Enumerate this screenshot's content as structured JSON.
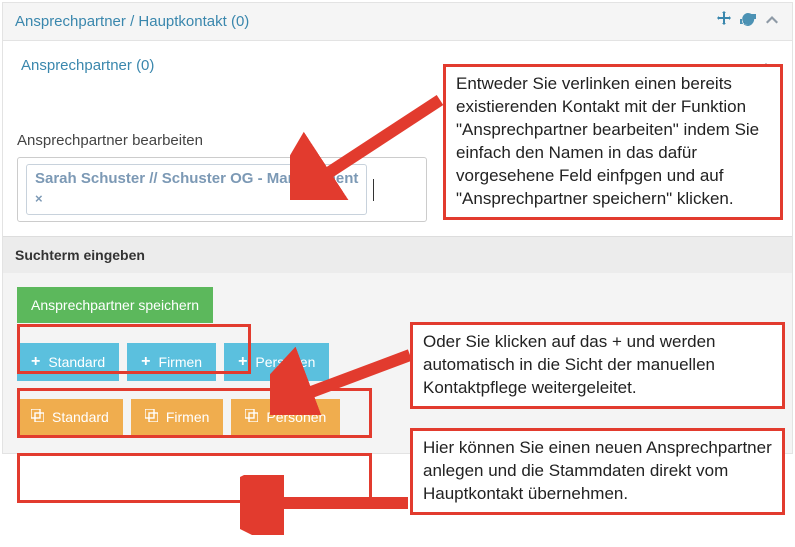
{
  "header": {
    "title": "Ansprechpartner / Hauptkontakt (0)"
  },
  "sub": {
    "title": "Ansprechpartner (0)"
  },
  "section": {
    "edit_label": "Ansprechpartner bearbeiten",
    "tag_text": "Sarah Schuster // Schuster OG - Management",
    "search_placeholder": "Suchterm eingeben"
  },
  "buttons": {
    "save": "Ansprechpartner speichern",
    "add_standard": "Standard",
    "add_firmen": "Firmen",
    "add_personen": "Personen",
    "copy_standard": "Standard",
    "copy_firmen": "Firmen",
    "copy_personen": "Personen"
  },
  "callouts": {
    "c1": "Entweder Sie verlinken einen bereits existierenden Kontakt mit der Funktion \"Ansprechpartner bearbeiten\" indem Sie einfach den Namen in das dafür vorgesehene Feld einfpgen und auf \"Ansprechpartner speichern\" klicken.",
    "c2": "Oder Sie klicken auf das + und werden automatisch in die Sicht der manuellen Kontaktpflege weitergeleitet.",
    "c3": "Hier können Sie einen neuen Ansprechpartner anlegen und die Stammdaten direkt vom Hauptkontakt übernehmen."
  },
  "colors": {
    "accent": "#3a87ad",
    "annotation": "#e23b2e",
    "btn_green": "#5cb85c",
    "btn_blue": "#5bc0de",
    "btn_orange": "#f0ad4e"
  }
}
